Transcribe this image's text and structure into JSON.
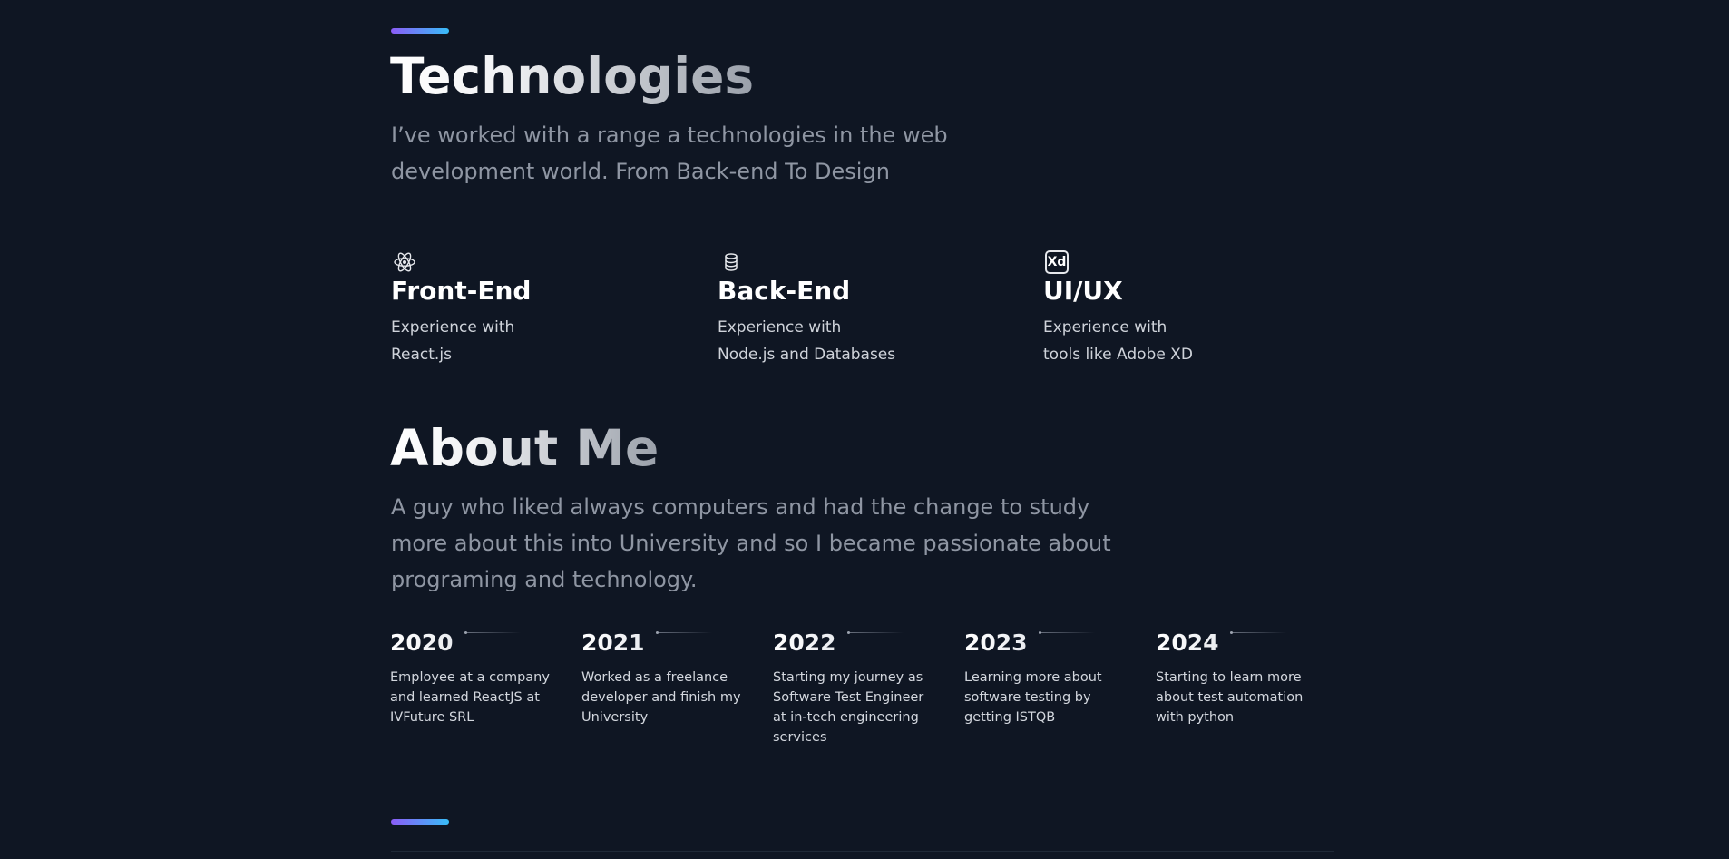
{
  "technologies": {
    "title": "Technologies",
    "lead": "I’ve worked with a range a technologies in the web development world. From Back-end To Design",
    "cards": [
      {
        "icon": "react-atom-icon",
        "title": "Front-End",
        "desc_line1": "Experience with",
        "desc_line2": "React.js"
      },
      {
        "icon": "database-icon",
        "title": "Back-End",
        "desc_line1": "Experience with",
        "desc_line2": "Node.js and Databases"
      },
      {
        "icon": "adobe-xd-icon",
        "icon_text": "Xd",
        "title": "UI/UX",
        "desc_line1": "Experience with",
        "desc_line2": "tools like Adobe XD"
      }
    ]
  },
  "about": {
    "title": "About Me",
    "lead": "A guy who liked always computers and had the change to study more about this into University and so I became passionate about programing and technology.",
    "timeline": [
      {
        "year": "2020",
        "desc": "Employee at a company and learned ReactJS at IVFuture SRL"
      },
      {
        "year": "2021",
        "desc": "Worked as a freelance developer and finish my University"
      },
      {
        "year": "2022",
        "desc": "Starting my journey as Software Test Engineer at in-tech engineering services"
      },
      {
        "year": "2023",
        "desc": "Learning more about software testing by getting ISTQB"
      },
      {
        "year": "2024",
        "desc": "Starting to learn more about test automation with python"
      }
    ]
  },
  "colors": {
    "background": "#0f1623",
    "accent_gradient_start": "#8b5cf6",
    "accent_gradient_end": "#38bdf8",
    "muted_text": "#8f96a3"
  }
}
